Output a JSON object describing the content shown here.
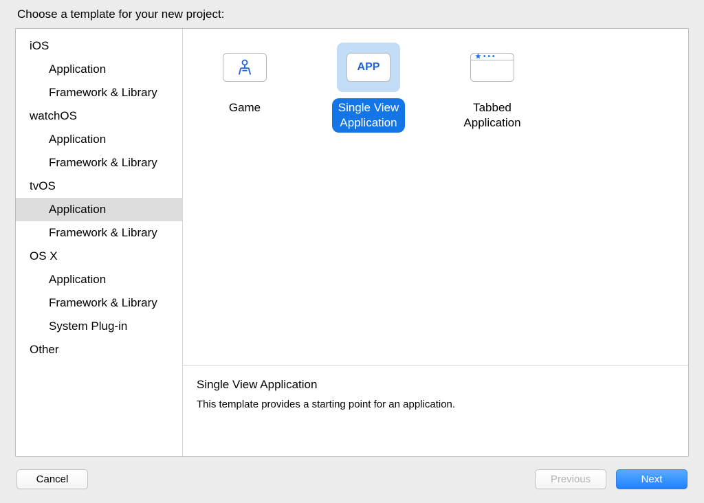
{
  "header": {
    "title": "Choose a template for your new project:"
  },
  "sidebar": {
    "platforms": [
      {
        "name": "iOS",
        "items": [
          "Application",
          "Framework & Library"
        ]
      },
      {
        "name": "watchOS",
        "items": [
          "Application",
          "Framework & Library"
        ]
      },
      {
        "name": "tvOS",
        "items": [
          "Application",
          "Framework & Library"
        ],
        "selectedIndex": 0
      },
      {
        "name": "OS X",
        "items": [
          "Application",
          "Framework & Library",
          "System Plug-in"
        ]
      },
      {
        "name": "Other",
        "items": []
      }
    ]
  },
  "templates": [
    {
      "label": "Game",
      "icon": "game-controller-icon",
      "selected": false
    },
    {
      "label": "Single View\nApplication",
      "icon": "app-text-icon",
      "iconText": "APP",
      "selected": true
    },
    {
      "label": "Tabbed\nApplication",
      "icon": "tabbed-window-icon",
      "selected": false
    }
  ],
  "detail": {
    "title": "Single View Application",
    "description": "This template provides a starting point for an application."
  },
  "buttons": {
    "cancel": "Cancel",
    "previous": "Previous",
    "next": "Next"
  }
}
